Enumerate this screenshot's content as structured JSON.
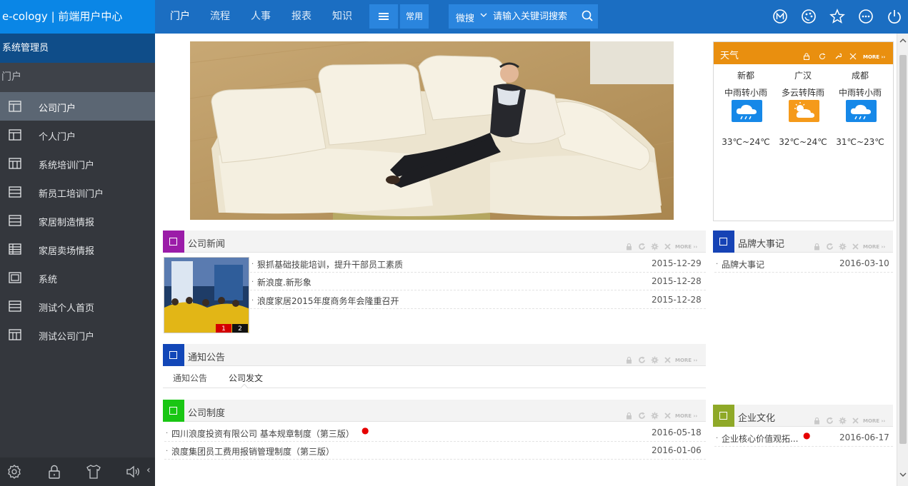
{
  "app": {
    "title": "e-cology | 前端用户中心"
  },
  "topnav": {
    "items": [
      "门户",
      "流程",
      "人事",
      "报表",
      "知识"
    ],
    "common_label": "常用"
  },
  "search": {
    "scope": "微搜",
    "placeholder": "请输入关键词搜索"
  },
  "top_icons": [
    "m-icon",
    "palette-icon",
    "star-icon",
    "more-icon",
    "power-icon"
  ],
  "sidebar": {
    "user": "系统管理员",
    "section": "门户",
    "items": [
      {
        "label": "公司门户",
        "icon": "layout-icon"
      },
      {
        "label": "个人门户",
        "icon": "layout-icon"
      },
      {
        "label": "系统培训门户",
        "icon": "layout-icon"
      },
      {
        "label": "新员工培训门户",
        "icon": "layout-icon"
      },
      {
        "label": "家居制造情报",
        "icon": "layout-icon"
      },
      {
        "label": "家居卖场情报",
        "icon": "grid-icon"
      },
      {
        "label": "系统",
        "icon": "layout-icon"
      },
      {
        "label": "测试个人首页",
        "icon": "list-icon"
      },
      {
        "label": "测试公司门户",
        "icon": "columns-icon"
      }
    ],
    "footer_icons": [
      "settings-icon",
      "lock-icon",
      "shirt-icon",
      "volume-icon"
    ],
    "collapse": "‹"
  },
  "weather": {
    "title": "天气",
    "more": "MORE ››",
    "cities": [
      {
        "name": "新都",
        "condition": "中雨转小雨",
        "temp": "33℃~24℃",
        "icon": "rain-cloud-icon",
        "color": "#1688e8"
      },
      {
        "name": "广汉",
        "condition": "多云转阵雨",
        "temp": "32℃~24℃",
        "icon": "sun-cloud-icon",
        "color": "#f59a1a"
      },
      {
        "name": "成都",
        "condition": "中雨转小雨",
        "temp": "31℃~23℃",
        "icon": "rain-cloud-icon",
        "color": "#1688e8"
      }
    ]
  },
  "portlets": {
    "news": {
      "title": "公司新闻",
      "badge_color": "#9b1ca8",
      "more": "MORE ››",
      "image_pages": [
        "1",
        "2"
      ],
      "items": [
        {
          "text": "狠抓基础技能培训，提升干部员工素质",
          "date": "2015-12-29"
        },
        {
          "text": "新浪度.新形象",
          "date": "2015-12-28"
        },
        {
          "text": "浪度家居2015年度商务年会隆重召开",
          "date": "2015-12-28"
        }
      ]
    },
    "notice": {
      "title": "通知公告",
      "badge_color": "#1247b8",
      "more": "MORE ››",
      "tabs": [
        "通知公告",
        "公司发文"
      ]
    },
    "policy": {
      "title": "公司制度",
      "badge_color": "#19c613",
      "more": "MORE ››",
      "items": [
        {
          "text": "四川浪度投资有限公司 基本规章制度（第三版）",
          "date": "2016-05-18",
          "new": "●"
        },
        {
          "text": "浪度集团员工费用报销管理制度（第三版）",
          "date": "2016-01-06"
        }
      ]
    },
    "brand": {
      "title": "品牌大事记",
      "badge_color": "#1643b5",
      "more": "MORE ››",
      "items": [
        {
          "text": "品牌大事记",
          "date": "2016-03-10"
        }
      ]
    },
    "culture": {
      "title": "企业文化",
      "badge_color": "#8fa928",
      "more": "MORE ››",
      "items": [
        {
          "text": "企业核心价值观拓...",
          "date": "2016-06-17",
          "new": "●"
        }
      ]
    }
  }
}
